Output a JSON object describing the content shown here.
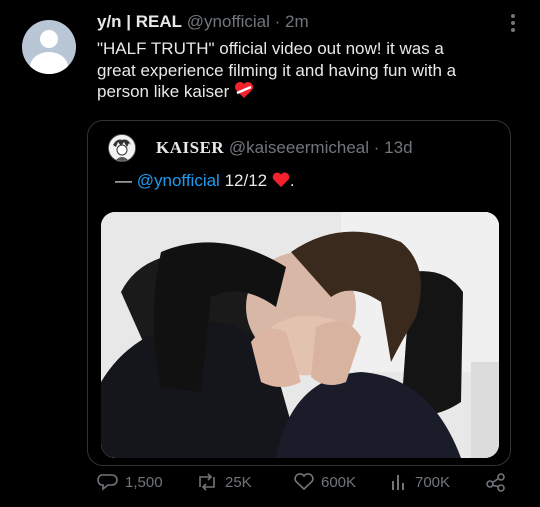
{
  "tweet": {
    "display_name": "y/n | REAL",
    "handle": "@ynofficial",
    "separator": "·",
    "time": "2m",
    "text_line1": "\"HALF TRUTH\" official video out now! it was a",
    "text_line2": "great experience filming it and having fun with a",
    "text_line3": "person like kaiser",
    "emoji": "heart-ribbon-emoji"
  },
  "quote": {
    "display_name": "KAISER",
    "handle": "@kaiseeermicheal",
    "separator": "·",
    "time": "13d",
    "dash": "—",
    "mention": "@ynofficial",
    "text_after": "12/12",
    "end": ".",
    "media": "photo"
  },
  "actions": {
    "replies": "1,500",
    "retweets": "25K",
    "likes": "600K",
    "views": "700K"
  },
  "colors": {
    "background": "#000000",
    "text": "#e7e9ea",
    "muted": "#71767b",
    "link": "#1d9bf0",
    "heart": "#f4212e",
    "border": "#2f3336"
  }
}
